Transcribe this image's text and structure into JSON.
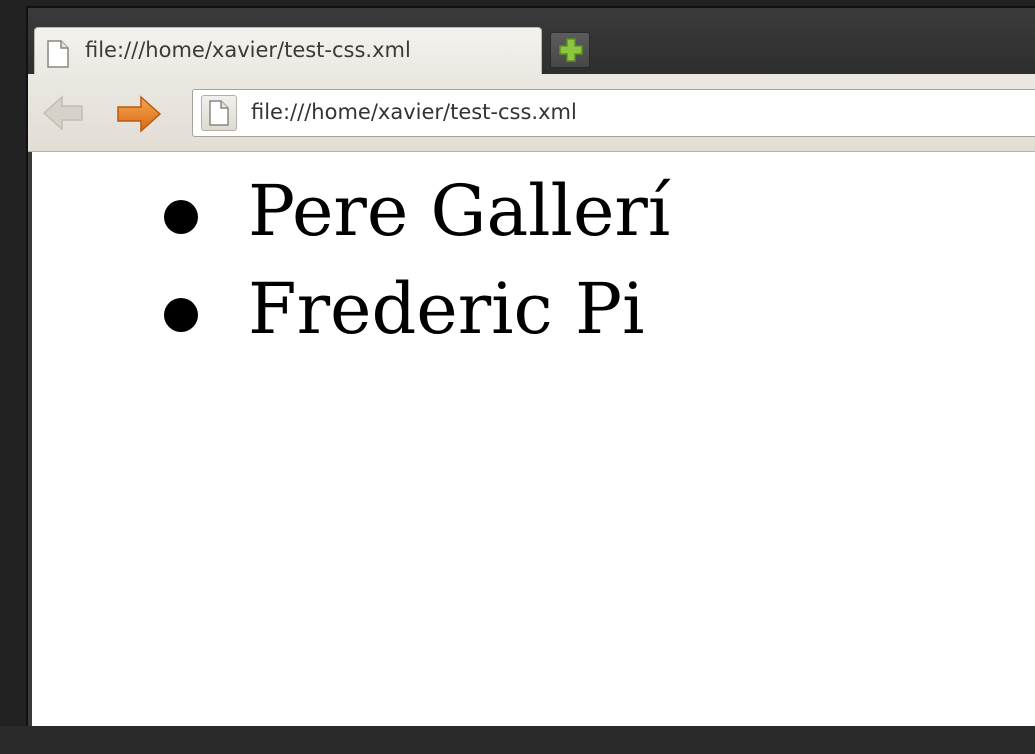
{
  "browser": {
    "tab": {
      "title": "file:///home/xavier/test-css.xml",
      "icon": "page-icon"
    },
    "new_tab_icon": "plus-icon",
    "toolbar": {
      "back_icon": "back-arrow-icon",
      "forward_icon": "forward-arrow-icon",
      "url": "file:///home/xavier/test-css.xml",
      "url_icon": "page-icon"
    }
  },
  "page": {
    "items": [
      {
        "text": "Pere Gallerí"
      },
      {
        "text": "Frederic Pi"
      }
    ]
  },
  "colors": {
    "forward_arrow": "#e8822a",
    "new_tab_plus": "#8cc63f",
    "back_arrow_disabled": "#d6d2ca"
  }
}
